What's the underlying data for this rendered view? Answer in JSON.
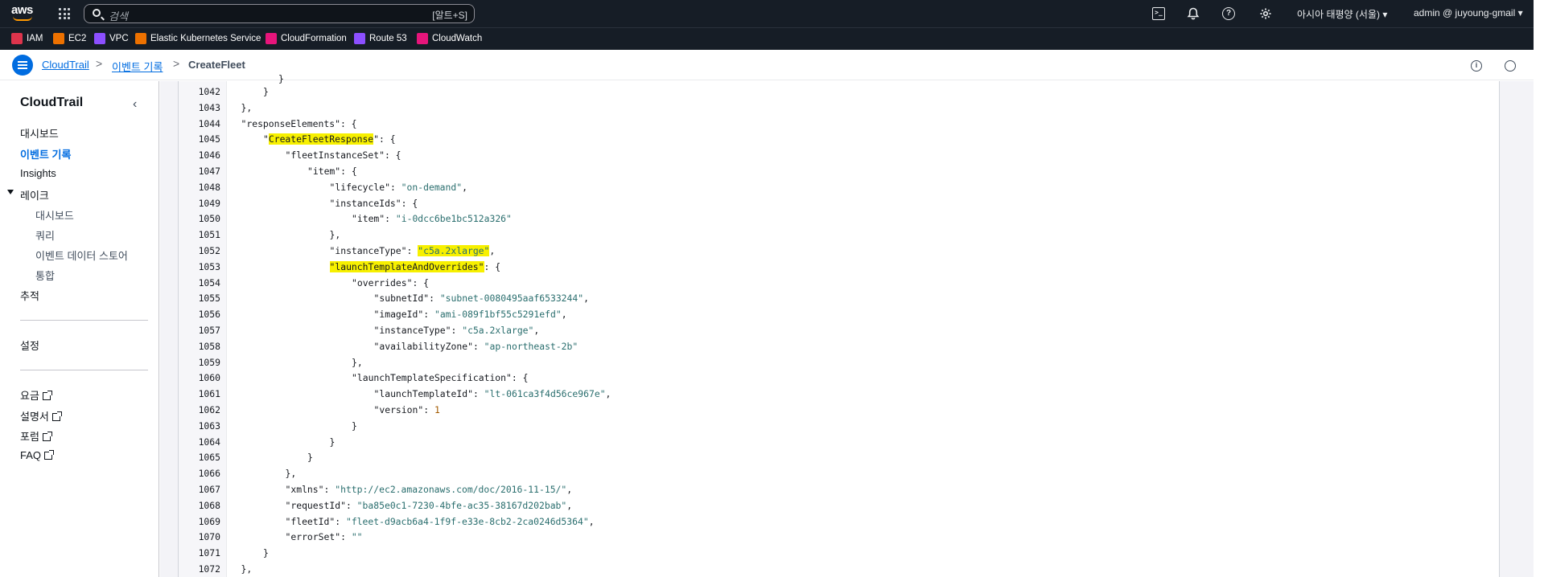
{
  "topnav": {
    "logo": "aws",
    "search_placeholder": "검색",
    "search_shortcut": "[알트+S]",
    "region": "아시아 태평양 (서울) ▾",
    "account": "admin @ juyoung-gmail ▾"
  },
  "favorites": [
    {
      "label": "IAM",
      "color": "#dd344c"
    },
    {
      "label": "EC2",
      "color": "#ed7100"
    },
    {
      "label": "VPC",
      "color": "#8c4fff"
    },
    {
      "label": "Elastic Kubernetes Service",
      "color": "#ed7100"
    },
    {
      "label": "CloudFormation",
      "color": "#e7157b"
    },
    {
      "label": "Route 53",
      "color": "#8c4fff"
    },
    {
      "label": "CloudWatch",
      "color": "#e7157b"
    }
  ],
  "breadcrumb": {
    "root": "CloudTrail",
    "sep": ">",
    "parent": "이벤트 기록",
    "current": "CreateFleet"
  },
  "sidebar": {
    "title": "CloudTrail",
    "collapse": "‹",
    "items": [
      {
        "label": "대시보드"
      },
      {
        "label": "이벤트 기록"
      },
      {
        "label": "Insights"
      },
      {
        "label": "레이크"
      },
      {
        "label": "대시보드"
      },
      {
        "label": "쿼리"
      },
      {
        "label": "이벤트 데이터 스토어"
      },
      {
        "label": "통합"
      },
      {
        "label": "추적"
      },
      {
        "label": "설정"
      },
      {
        "label": "요금"
      },
      {
        "label": "설명서"
      },
      {
        "label": "포럼"
      },
      {
        "label": "FAQ"
      }
    ]
  },
  "code": {
    "lines": [
      {
        "no": "1042",
        "indent": 2,
        "text": "}"
      },
      {
        "no": "1043",
        "indent": 1,
        "text": "},"
      },
      {
        "no": "1044",
        "indent": 1,
        "key": "responseElements",
        "rest": ": {"
      },
      {
        "no": "1045",
        "indent": 2,
        "key": "CreateFleetResponse",
        "rest": ": {",
        "highlight": "key"
      },
      {
        "no": "1046",
        "indent": 3,
        "key": "fleetInstanceSet",
        "rest": ": {"
      },
      {
        "no": "1047",
        "indent": 4,
        "key": "item",
        "rest": ": {"
      },
      {
        "no": "1048",
        "indent": 5,
        "key": "lifecycle",
        "value": "on-demand",
        "after": ","
      },
      {
        "no": "1049",
        "indent": 5,
        "key": "instanceIds",
        "rest": ": {"
      },
      {
        "no": "1050",
        "indent": 6,
        "key": "item",
        "value": "i-0dcc6be1bc512a326",
        "after": ""
      },
      {
        "no": "1051",
        "indent": 5,
        "text": "},"
      },
      {
        "no": "1052",
        "indent": 5,
        "key": "instanceType",
        "value": "c5a.2xlarge",
        "after": ",",
        "highlight": "value"
      },
      {
        "no": "1053",
        "indent": 5,
        "key": "launchTemplateAndOverrides",
        "rest": ": {",
        "highlight": "key-full"
      },
      {
        "no": "1054",
        "indent": 6,
        "key": "overrides",
        "rest": ": {"
      },
      {
        "no": "1055",
        "indent": 7,
        "key": "subnetId",
        "value": "subnet-0080495aaf6533244",
        "after": ","
      },
      {
        "no": "1056",
        "indent": 7,
        "key": "imageId",
        "value": "ami-089f1bf55c5291efd",
        "after": ","
      },
      {
        "no": "1057",
        "indent": 7,
        "key": "instanceType",
        "value": "c5a.2xlarge",
        "after": ","
      },
      {
        "no": "1058",
        "indent": 7,
        "key": "availabilityZone",
        "value": "ap-northeast-2b",
        "after": ""
      },
      {
        "no": "1059",
        "indent": 6,
        "text": "},"
      },
      {
        "no": "1060",
        "indent": 6,
        "key": "launchTemplateSpecification",
        "rest": ": {"
      },
      {
        "no": "1061",
        "indent": 7,
        "key": "launchTemplateId",
        "value": "lt-061ca3f4d56ce967e",
        "after": ","
      },
      {
        "no": "1062",
        "indent": 7,
        "key": "version",
        "number": "1",
        "after": ""
      },
      {
        "no": "1063",
        "indent": 6,
        "text": "}"
      },
      {
        "no": "1064",
        "indent": 5,
        "text": "}"
      },
      {
        "no": "1065",
        "indent": 4,
        "text": "}"
      },
      {
        "no": "1066",
        "indent": 3,
        "text": "},"
      },
      {
        "no": "1067",
        "indent": 3,
        "key": "xmlns",
        "value": "http://ec2.amazonaws.com/doc/2016-11-15/",
        "after": ","
      },
      {
        "no": "1068",
        "indent": 3,
        "key": "requestId",
        "value": "ba85e0c1-7230-4bfe-ac35-38167d202bab",
        "after": ","
      },
      {
        "no": "1069",
        "indent": 3,
        "key": "fleetId",
        "value": "fleet-d9acb6a4-1f9f-e33e-8cb2-2ca0246d5364",
        "after": ","
      },
      {
        "no": "1070",
        "indent": 3,
        "key": "errorSet",
        "value": "",
        "after": ""
      },
      {
        "no": "1071",
        "indent": 2,
        "text": "}"
      },
      {
        "no": "1072",
        "indent": 1,
        "text": "},"
      }
    ]
  },
  "colors": {
    "nav_bg": "#161d26",
    "link": "#006ce0",
    "highlight": "#f7f000",
    "string": "#2a6e6e",
    "number": "#a35a00"
  }
}
